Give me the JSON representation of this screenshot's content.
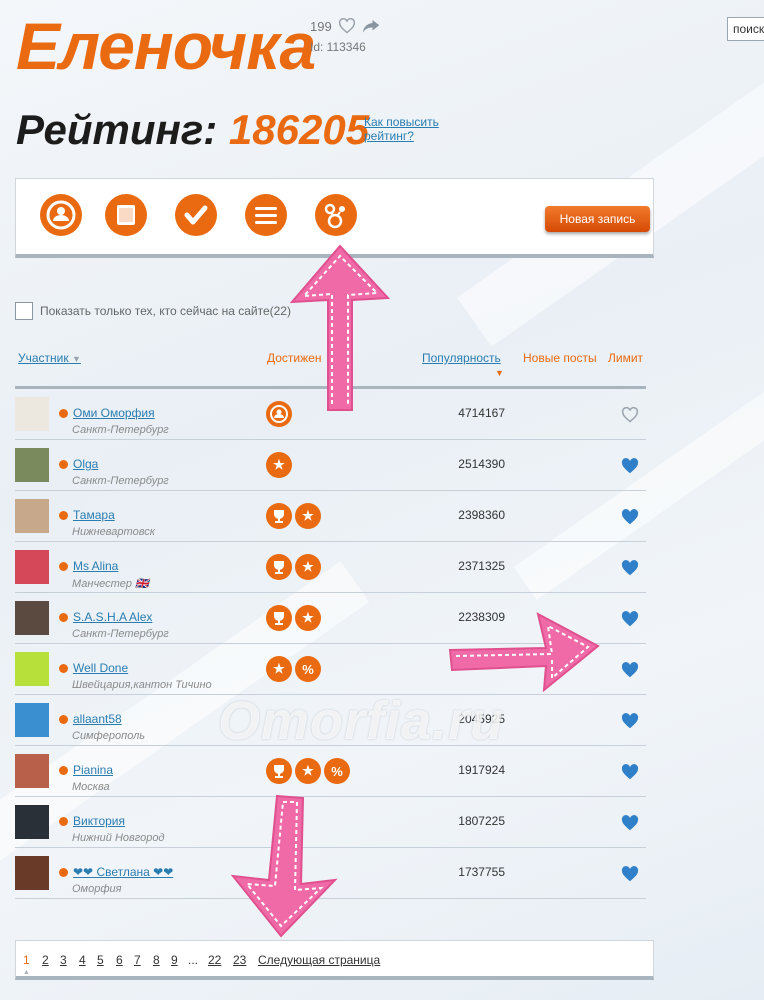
{
  "header": {
    "user_name": "Еленочка",
    "likes_count": "199",
    "user_id": "Id: 113346",
    "search_label": "поиск"
  },
  "rating": {
    "label": "Рейтинг:",
    "value": "186205",
    "how_to_raise": "Как повысить рейтинг?"
  },
  "toolbar": {
    "icons": [
      "profile-icon",
      "notepad-icon",
      "check-icon",
      "menu-icon",
      "network-icon"
    ],
    "new_post_label": "Новая запись"
  },
  "filter": {
    "online_only_label": "Показать только тех, кто сейчас на сайте(22)"
  },
  "table": {
    "columns": {
      "participant": "Участник",
      "achievements": "Достижен",
      "popularity": "Популярность",
      "new_posts": "Новые посты",
      "limit": "Лимит"
    },
    "rows": [
      {
        "name": "Оми Оморфия",
        "city": "Санкт-Петербург",
        "achievements": [
          "profile"
        ],
        "popularity": "4714167",
        "liked": false,
        "avatar": "#ece8e0"
      },
      {
        "name": "Olga",
        "city": "Санкт-Петербург",
        "achievements": [
          "star"
        ],
        "popularity": "2514390",
        "liked": true,
        "avatar": "#7a8a5c"
      },
      {
        "name": "Тамара",
        "city": "Нижневартовск",
        "achievements": [
          "trophy",
          "star"
        ],
        "popularity": "2398360",
        "liked": true,
        "avatar": "#c8a88a"
      },
      {
        "name": "Ms Alina",
        "city": "Манчестер 🇬🇧",
        "achievements": [
          "trophy",
          "star"
        ],
        "popularity": "2371325",
        "liked": true,
        "avatar": "#d4485a"
      },
      {
        "name": "S.A.S.H.A Alex",
        "city": "Санкт-Петербург",
        "achievements": [
          "trophy",
          "star"
        ],
        "popularity": "2238309",
        "liked": true,
        "avatar": "#5a4a40"
      },
      {
        "name": "Well Done",
        "city": "Швейцария,кантон Тичино",
        "achievements": [
          "star",
          "percent"
        ],
        "popularity": "",
        "liked": true,
        "avatar": "#b7e03a"
      },
      {
        "name": "allaant58",
        "city": "Симферополь",
        "achievements": [],
        "popularity": "2045925",
        "liked": true,
        "avatar": "#3a8fd0"
      },
      {
        "name": "Pianina",
        "city": "Москва",
        "achievements": [
          "trophy",
          "star",
          "percent"
        ],
        "popularity": "1917924",
        "liked": true,
        "avatar": "#b8604a"
      },
      {
        "name": "Виктория",
        "city": "Нижний Новгород",
        "achievements": [],
        "popularity": "1807225",
        "liked": true,
        "avatar": "#2a3038"
      },
      {
        "name": "❤❤ Светлана ❤❤",
        "city": "Оморфия",
        "achievements": [],
        "popularity": "1737755",
        "liked": true,
        "avatar": "#6a3a28"
      }
    ]
  },
  "pagination": {
    "pages": [
      "1",
      "2",
      "3",
      "4",
      "5",
      "6",
      "7",
      "8",
      "9",
      "...",
      "22",
      "23"
    ],
    "current": "1",
    "next_label": "Следующая страница"
  },
  "watermark": "Omorfia.ru",
  "colors": {
    "accent": "#ea6a12",
    "link": "#2a7db0",
    "heart_active": "#2f80c9",
    "annotation_arrow": "#f06aa8"
  }
}
